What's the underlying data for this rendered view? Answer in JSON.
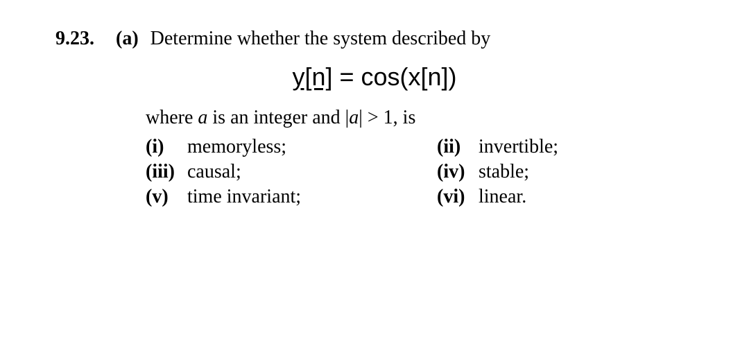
{
  "problem": {
    "number": "9.23.",
    "part_label": "(a)",
    "intro_text": "Determine whether the system described by"
  },
  "equation": {
    "lhs": "y[n]",
    "eq": " = ",
    "rhs": "cos(x[n])"
  },
  "where_clause": {
    "prefix": "where ",
    "var": "a",
    "mid": " is an integer and |",
    "var2": "a",
    "suffix": "| > 1, is"
  },
  "options": {
    "row1": {
      "left": {
        "label": "(i)",
        "text": "memoryless;"
      },
      "right": {
        "label": "(ii)",
        "text": "invertible;"
      }
    },
    "row2": {
      "left": {
        "label": "(iii)",
        "text": "causal;"
      },
      "right": {
        "label": "(iv)",
        "text": "stable;"
      }
    },
    "row3": {
      "left": {
        "label": "(v)",
        "text": "time invariant;"
      },
      "right": {
        "label": "(vi)",
        "text": "linear."
      }
    }
  }
}
